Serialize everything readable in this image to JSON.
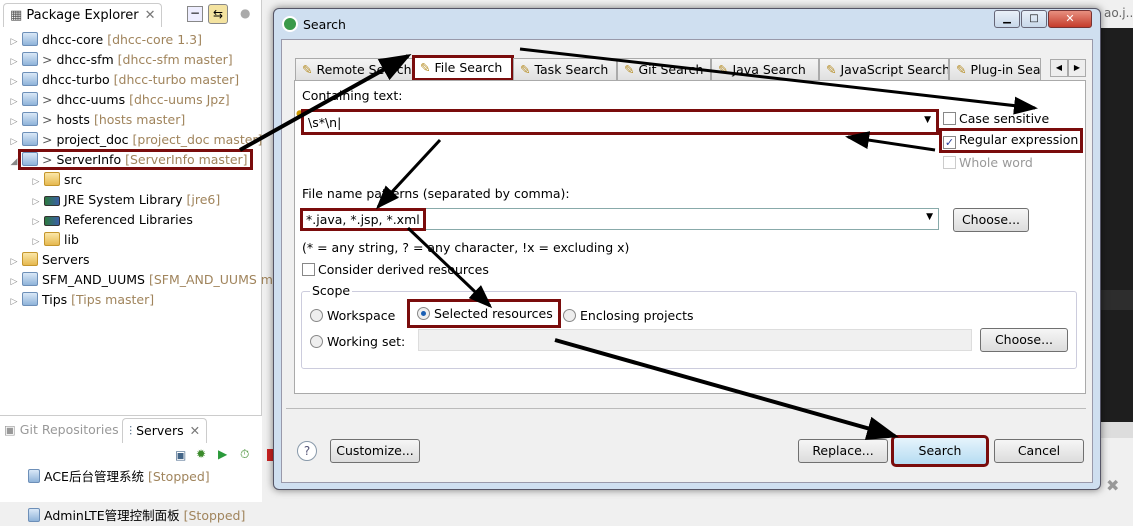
{
  "package_explorer": {
    "title": "Package Explorer",
    "items": [
      {
        "name": "dhcc-core",
        "decoration": "[dhcc-core 1.3]",
        "prefix": "",
        "expanded": false,
        "level": 0,
        "icon": "maven-project-warning-icon"
      },
      {
        "name": "dhcc-sfm",
        "decoration": "[dhcc-sfm master]",
        "prefix": "> ",
        "expanded": false,
        "level": 0,
        "icon": "maven-project-error-icon"
      },
      {
        "name": "dhcc-turbo",
        "decoration": "[dhcc-turbo master]",
        "prefix": "",
        "expanded": false,
        "level": 0,
        "icon": "maven-project-error-icon"
      },
      {
        "name": "dhcc-uums",
        "decoration": "[dhcc-uums Jpz]",
        "prefix": "> ",
        "expanded": false,
        "level": 0,
        "icon": "maven-project-error-icon"
      },
      {
        "name": "hosts",
        "decoration": "[hosts master]",
        "prefix": "> ",
        "expanded": false,
        "level": 0,
        "icon": "project-icon"
      },
      {
        "name": "project_doc",
        "decoration": "[project_doc master]",
        "prefix": "> ",
        "expanded": false,
        "level": 0,
        "icon": "java-project-error-icon"
      },
      {
        "name": "ServerInfo",
        "decoration": "[ServerInfo master]",
        "prefix": "> ",
        "expanded": true,
        "level": 0,
        "icon": "java-project-icon",
        "highlighted": true
      },
      {
        "name": "src",
        "decoration": "",
        "prefix": "",
        "expanded": false,
        "level": 1,
        "icon": "source-folder-icon"
      },
      {
        "name": "JRE System Library",
        "decoration": "[jre6]",
        "prefix": "",
        "expanded": false,
        "level": 1,
        "icon": "library-icon"
      },
      {
        "name": "Referenced Libraries",
        "decoration": "",
        "prefix": "",
        "expanded": false,
        "level": 1,
        "icon": "library-icon"
      },
      {
        "name": "lib",
        "decoration": "",
        "prefix": "",
        "expanded": false,
        "level": 1,
        "icon": "folder-icon"
      },
      {
        "name": "Servers",
        "decoration": "",
        "prefix": "",
        "expanded": false,
        "level": 0,
        "icon": "folder-icon"
      },
      {
        "name": "SFM_AND_UUMS",
        "decoration": "[SFM_AND_UUMS master]",
        "prefix": "",
        "expanded": false,
        "level": 0,
        "icon": "project-icon"
      },
      {
        "name": "Tips",
        "decoration": "[Tips master]",
        "prefix": "",
        "expanded": false,
        "level": 0,
        "icon": "project-icon"
      }
    ]
  },
  "bottom_views": {
    "tabs": [
      {
        "label": "Git Repositories",
        "active": false
      },
      {
        "label": "Servers",
        "active": true
      }
    ],
    "servers": [
      {
        "name": "ACE后台管理系统",
        "status": "[Stopped]"
      },
      {
        "name": "AdminLTE管理控制面板",
        "status": "[Stopped]"
      }
    ]
  },
  "editor": {
    "tab_fragment": "ao.j..."
  },
  "dialog": {
    "title": "Search",
    "tabs": [
      {
        "label": "Remote Search",
        "active": false
      },
      {
        "label": "File Search",
        "active": true
      },
      {
        "label": "Task Search",
        "active": false
      },
      {
        "label": "Git Search",
        "active": false
      },
      {
        "label": "Java Search",
        "active": false
      },
      {
        "label": "JavaScript Search",
        "active": false
      },
      {
        "label": "Plug-in Search",
        "active": false
      }
    ],
    "containing_text_label": "Containing text:",
    "containing_text_value": "\\s*\\n",
    "options": [
      {
        "label": "Case sensitive",
        "checked": false,
        "enabled": true
      },
      {
        "label": "Regular expression",
        "checked": true,
        "enabled": true
      },
      {
        "label": "Whole word",
        "checked": false,
        "enabled": false
      }
    ],
    "file_patterns_label": "File name patterns (separated by comma):",
    "file_patterns_value": "*.java, *.jsp, *.xml",
    "choose_label": "Choose...",
    "patterns_hint": "(* = any string, ? = any character, !x = excluding x)",
    "derived_label": "Consider derived resources",
    "derived_checked": false,
    "scope": {
      "title": "Scope",
      "options": [
        {
          "label": "Workspace",
          "selected": false
        },
        {
          "label": "Selected resources",
          "selected": true
        },
        {
          "label": "Enclosing projects",
          "selected": false
        }
      ],
      "working_set_label": "Working set:",
      "working_set_value": "",
      "choose_label": "Choose..."
    },
    "buttons": {
      "customize": "Customize...",
      "replace": "Replace...",
      "search": "Search",
      "cancel": "Cancel"
    }
  },
  "colors": {
    "highlight": "#7a0c0c",
    "arrow": "#000000"
  }
}
